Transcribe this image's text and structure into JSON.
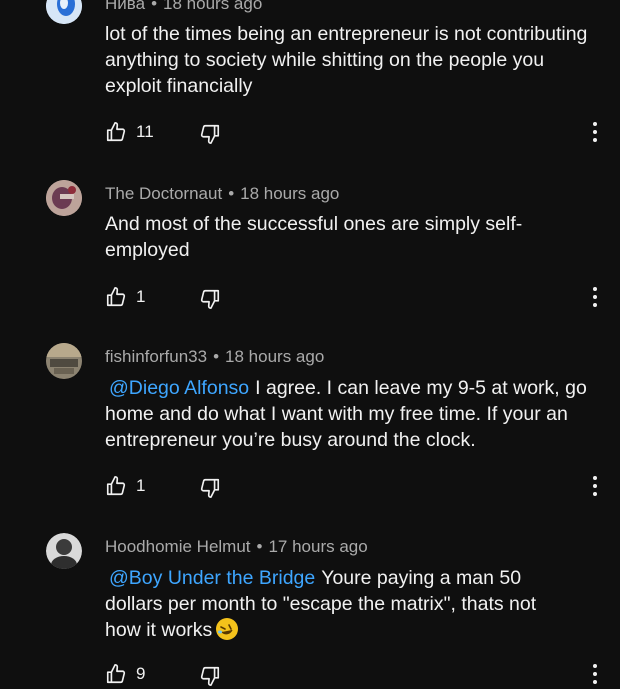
{
  "comments": [
    {
      "author": "Нива",
      "time": "18 hours ago",
      "mention": "",
      "text": "lot of the times being an entrepreneur is not contributing anything to society while shitting on the people you exploit financially",
      "likes": "11",
      "avatar_colors": [
        "#2a6fd6",
        "#d7e6f7"
      ]
    },
    {
      "author": "The Doctornaut",
      "time": "18 hours ago",
      "mention": "",
      "text": "And most of the successful ones are simply self-employed",
      "likes": "1",
      "avatar_colors": [
        "#6b3b52",
        "#c9b0a8"
      ]
    },
    {
      "author": "fishinforfun33",
      "time": "18 hours ago",
      "mention": "@Diego Alfonso",
      "text": "I agree. I can leave my 9-5 at work, go home and do what I want with my free time. If your an entrepreneur you’re busy around the clock.",
      "likes": "1",
      "avatar_colors": [
        "#6e6a5f",
        "#b8a98c"
      ]
    },
    {
      "author": "Hoodhomie Helmut",
      "time": "17 hours ago",
      "mention": "@Boy Under the Bridge",
      "text": "Youre paying a man 50 dollars per month to \"escape the matrix\", thats not how it works",
      "emoji": "rolling-on-floor-laughing-emoji",
      "likes": "9",
      "avatar_colors": [
        "#4a4a4a",
        "#d9d9d9"
      ]
    }
  ]
}
